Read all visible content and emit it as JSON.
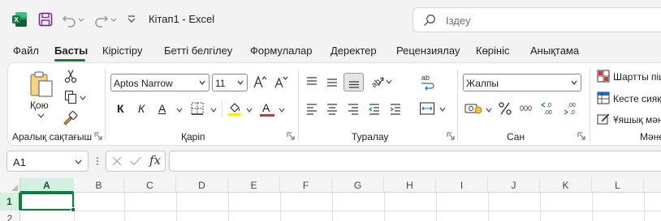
{
  "app": {
    "title": "Кітап1  -  Excel",
    "accent": "#107c41"
  },
  "search": {
    "placeholder": "Іздеу"
  },
  "tabs": [
    {
      "label": "Файл"
    },
    {
      "label": "Басты"
    },
    {
      "label": "Кірістіру"
    },
    {
      "label": "Бетті белгілеу"
    },
    {
      "label": "Формулалар"
    },
    {
      "label": "Деректер"
    },
    {
      "label": "Рецензиялау"
    },
    {
      "label": "Көрініс"
    },
    {
      "label": "Анықтама"
    }
  ],
  "ribbon": {
    "clipboard": {
      "label": "Аралық сақтағыш",
      "paste_label": "Қою"
    },
    "font": {
      "label": "Қаріп",
      "font_name": "Aptos Narrow",
      "font_size": "11",
      "bold": "К",
      "italic": "К",
      "font_color_label": "А",
      "highlight_color": "#ffef00",
      "font_color": "#d13438"
    },
    "alignment": {
      "label": "Туралау"
    },
    "number": {
      "label": "Сан",
      "format": "Жалпы"
    },
    "styles": {
      "label": "Мәне",
      "items": [
        "Шартты піш",
        "Кесте сияқ",
        "Ұяшық мән"
      ]
    }
  },
  "formula_bar": {
    "name_box": "A1",
    "fx": "fx"
  },
  "grid": {
    "columns": [
      "A",
      "B",
      "C",
      "D",
      "E",
      "F",
      "G",
      "H",
      "I",
      "J",
      "K",
      "L"
    ],
    "rows": [
      "1",
      "2"
    ],
    "selected_column": "A",
    "selected_row": "1"
  }
}
